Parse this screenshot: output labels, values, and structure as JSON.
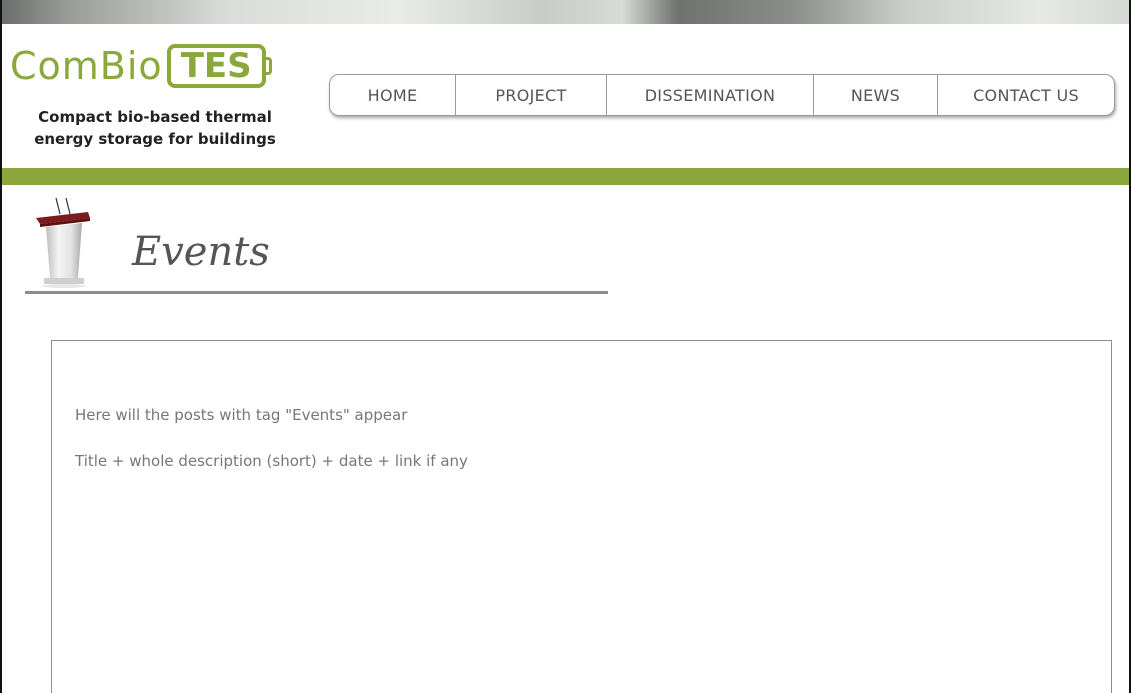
{
  "brand": {
    "logo_prefix": "ComBio",
    "logo_suffix": "TES",
    "tagline": "Compact bio-based thermal energy storage for buildings",
    "accent_color": "#8aa63c"
  },
  "nav": {
    "items": [
      {
        "label": "HOME"
      },
      {
        "label": "PROJECT"
      },
      {
        "label": "DISSEMINATION"
      },
      {
        "label": "NEWS"
      },
      {
        "label": "CONTACT US"
      }
    ]
  },
  "page": {
    "icon": "podium-icon",
    "title": "Events"
  },
  "content": {
    "line_1": "Here will the posts with tag \"Events\" appear",
    "line_2": "Title + whole description (short) + date + link if any"
  }
}
